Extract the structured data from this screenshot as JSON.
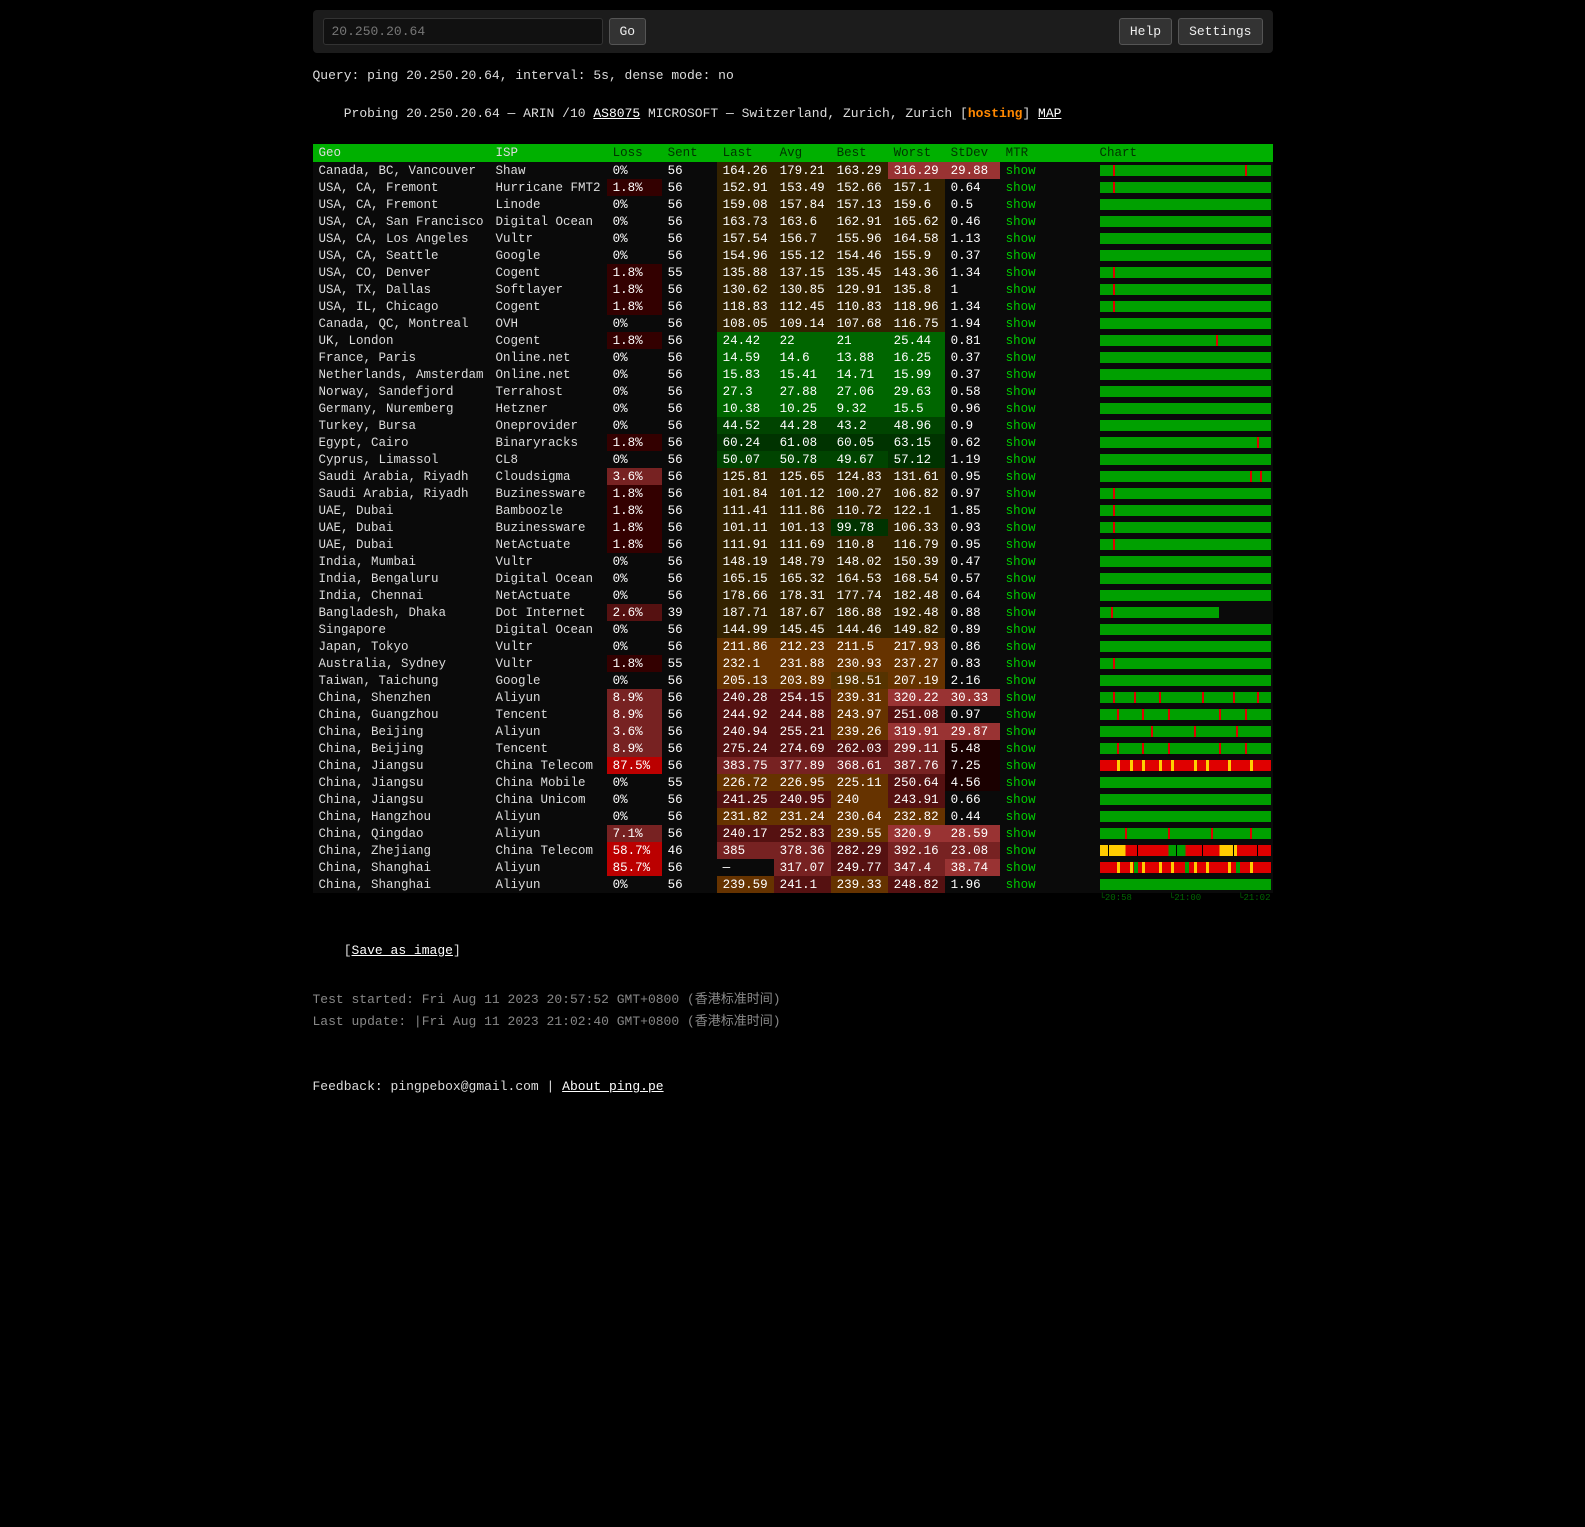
{
  "topbar": {
    "search_value": "20.250.20.64",
    "go_label": "Go",
    "help_label": "Help",
    "settings_label": "Settings"
  },
  "query_line": "Query: ping 20.250.20.64, interval: 5s, dense mode: no",
  "probe_line_pre": "Probing 20.250.20.64 — ARIN /10 ",
  "probe_asn": "AS8075",
  "probe_line_mid": " MICROSOFT — Switzerland, Zurich, Zurich [",
  "probe_hosting": "hosting",
  "probe_line_post": "] ",
  "probe_map": "MAP",
  "headers": {
    "geo": "Geo",
    "isp": "ISP",
    "loss": "Loss",
    "sent": "Sent",
    "last": "Last",
    "avg": "Avg",
    "best": "Best",
    "worst": "Worst",
    "stdev": "StDev",
    "mtr": "MTR",
    "chart": "Chart"
  },
  "mtr_show": "show",
  "rows": [
    {
      "geo": "Canada, BC, Vancouver",
      "isp": "Shaw",
      "loss": "0%",
      "sent": "56",
      "last": "164.26",
      "avg": "179.21",
      "best": "163.29",
      "worst": "316.29",
      "stdev": "29.88",
      "loss_bg": "",
      "last_bg": "bg-y1",
      "avg_bg": "bg-y1",
      "best_bg": "bg-y1",
      "worst_bg": "bg-r3",
      "stdev_bg": "bg-r3",
      "chart": "green_marks"
    },
    {
      "geo": "USA, CA, Fremont",
      "isp": "Hurricane FMT2",
      "loss": "1.8%",
      "sent": "56",
      "last": "152.91",
      "avg": "153.49",
      "best": "152.66",
      "worst": "157.1",
      "stdev": "0.64",
      "loss_bg": "bg-r5",
      "last_bg": "bg-y1",
      "avg_bg": "bg-y1",
      "best_bg": "bg-y1",
      "worst_bg": "bg-y1",
      "stdev_bg": "",
      "chart": "green_1mark"
    },
    {
      "geo": "USA, CA, Fremont",
      "isp": "Linode",
      "loss": "0%",
      "sent": "56",
      "last": "159.08",
      "avg": "157.84",
      "best": "157.13",
      "worst": "159.6",
      "stdev": "0.5",
      "loss_bg": "",
      "last_bg": "bg-y1",
      "avg_bg": "bg-y1",
      "best_bg": "bg-y1",
      "worst_bg": "bg-y1",
      "stdev_bg": "",
      "chart": "green"
    },
    {
      "geo": "USA, CA, San Francisco",
      "isp": "Digital Ocean",
      "loss": "0%",
      "sent": "56",
      "last": "163.73",
      "avg": "163.6",
      "best": "162.91",
      "worst": "165.62",
      "stdev": "0.46",
      "loss_bg": "",
      "last_bg": "bg-y1",
      "avg_bg": "bg-y1",
      "best_bg": "bg-y1",
      "worst_bg": "bg-y1",
      "stdev_bg": "",
      "chart": "green"
    },
    {
      "geo": "USA, CA, Los Angeles",
      "isp": "Vultr",
      "loss": "0%",
      "sent": "56",
      "last": "157.54",
      "avg": "156.7",
      "best": "155.96",
      "worst": "164.58",
      "stdev": "1.13",
      "loss_bg": "",
      "last_bg": "bg-y1",
      "avg_bg": "bg-y1",
      "best_bg": "bg-y1",
      "worst_bg": "bg-y1",
      "stdev_bg": "",
      "chart": "green"
    },
    {
      "geo": "USA, CA, Seattle",
      "isp": "Google",
      "loss": "0%",
      "sent": "56",
      "last": "154.96",
      "avg": "155.12",
      "best": "154.46",
      "worst": "155.9",
      "stdev": "0.37",
      "loss_bg": "",
      "last_bg": "bg-y1",
      "avg_bg": "bg-y1",
      "best_bg": "bg-y1",
      "worst_bg": "bg-y1",
      "stdev_bg": "",
      "chart": "green"
    },
    {
      "geo": "USA, CO, Denver",
      "isp": "Cogent",
      "loss": "1.8%",
      "sent": "55",
      "last": "135.88",
      "avg": "137.15",
      "best": "135.45",
      "worst": "143.36",
      "stdev": "1.34",
      "loss_bg": "bg-r5",
      "last_bg": "bg-y1",
      "avg_bg": "bg-y1",
      "best_bg": "bg-y1",
      "worst_bg": "bg-y1",
      "stdev_bg": "",
      "chart": "green_1mark"
    },
    {
      "geo": "USA, TX, Dallas",
      "isp": "Softlayer",
      "loss": "1.8%",
      "sent": "56",
      "last": "130.62",
      "avg": "130.85",
      "best": "129.91",
      "worst": "135.8",
      "stdev": "1",
      "loss_bg": "bg-r5",
      "last_bg": "bg-y1",
      "avg_bg": "bg-y1",
      "best_bg": "bg-y1",
      "worst_bg": "bg-y1",
      "stdev_bg": "",
      "chart": "green_1mark"
    },
    {
      "geo": "USA, IL, Chicago",
      "isp": "Cogent",
      "loss": "1.8%",
      "sent": "56",
      "last": "118.83",
      "avg": "112.45",
      "best": "110.83",
      "worst": "118.96",
      "stdev": "1.34",
      "loss_bg": "bg-r5",
      "last_bg": "bg-y1",
      "avg_bg": "bg-y1",
      "best_bg": "bg-y1",
      "worst_bg": "bg-y1",
      "stdev_bg": "",
      "chart": "green_1mark"
    },
    {
      "geo": "Canada, QC, Montreal",
      "isp": "OVH",
      "loss": "0%",
      "sent": "56",
      "last": "108.05",
      "avg": "109.14",
      "best": "107.68",
      "worst": "116.75",
      "stdev": "1.94",
      "loss_bg": "",
      "last_bg": "bg-y1",
      "avg_bg": "bg-y1",
      "best_bg": "bg-y1",
      "worst_bg": "bg-y1",
      "stdev_bg": "",
      "chart": "green"
    },
    {
      "geo": "UK, London",
      "isp": "Cogent",
      "loss": "1.8%",
      "sent": "56",
      "last": "24.42",
      "avg": "22",
      "best": "21",
      "worst": "25.44",
      "stdev": "0.81",
      "loss_bg": "bg-r5",
      "last_bg": "bg-g3",
      "avg_bg": "bg-g3",
      "best_bg": "bg-g3",
      "worst_bg": "bg-g3",
      "stdev_bg": "",
      "chart": "green_1mark_mid"
    },
    {
      "geo": "France, Paris",
      "isp": "Online.net",
      "loss": "0%",
      "sent": "56",
      "last": "14.59",
      "avg": "14.6",
      "best": "13.88",
      "worst": "16.25",
      "stdev": "0.37",
      "loss_bg": "",
      "last_bg": "bg-g3",
      "avg_bg": "bg-g3",
      "best_bg": "bg-g3",
      "worst_bg": "bg-g3",
      "stdev_bg": "",
      "chart": "green"
    },
    {
      "geo": "Netherlands, Amsterdam",
      "isp": "Online.net",
      "loss": "0%",
      "sent": "56",
      "last": "15.83",
      "avg": "15.41",
      "best": "14.71",
      "worst": "15.99",
      "stdev": "0.37",
      "loss_bg": "",
      "last_bg": "bg-g3",
      "avg_bg": "bg-g3",
      "best_bg": "bg-g3",
      "worst_bg": "bg-g3",
      "stdev_bg": "",
      "chart": "green"
    },
    {
      "geo": "Norway, Sandefjord",
      "isp": "Terrahost",
      "loss": "0%",
      "sent": "56",
      "last": "27.3",
      "avg": "27.88",
      "best": "27.06",
      "worst": "29.63",
      "stdev": "0.58",
      "loss_bg": "",
      "last_bg": "bg-g3",
      "avg_bg": "bg-g3",
      "best_bg": "bg-g3",
      "worst_bg": "bg-g3",
      "stdev_bg": "",
      "chart": "green"
    },
    {
      "geo": "Germany, Nuremberg",
      "isp": "Hetzner",
      "loss": "0%",
      "sent": "56",
      "last": "10.38",
      "avg": "10.25",
      "best": "9.32",
      "worst": "15.5",
      "stdev": "0.96",
      "loss_bg": "",
      "last_bg": "bg-g3",
      "avg_bg": "bg-g3",
      "best_bg": "bg-g3",
      "worst_bg": "bg-g3",
      "stdev_bg": "",
      "chart": "green"
    },
    {
      "geo": "Turkey, Bursa",
      "isp": "Oneprovider",
      "loss": "0%",
      "sent": "56",
      "last": "44.52",
      "avg": "44.28",
      "best": "43.2",
      "worst": "48.96",
      "stdev": "0.9",
      "loss_bg": "",
      "last_bg": "bg-g2",
      "avg_bg": "bg-g2",
      "best_bg": "bg-g2",
      "worst_bg": "bg-g2",
      "stdev_bg": "",
      "chart": "green"
    },
    {
      "geo": "Egypt, Cairo",
      "isp": "Binaryracks",
      "loss": "1.8%",
      "sent": "56",
      "last": "60.24",
      "avg": "61.08",
      "best": "60.05",
      "worst": "63.15",
      "stdev": "0.62",
      "loss_bg": "bg-r5",
      "last_bg": "bg-g1",
      "avg_bg": "bg-g1",
      "best_bg": "bg-g1",
      "worst_bg": "bg-g1",
      "stdev_bg": "",
      "chart": "green_1mark_end"
    },
    {
      "geo": "Cyprus, Limassol",
      "isp": "CL8",
      "loss": "0%",
      "sent": "56",
      "last": "50.07",
      "avg": "50.78",
      "best": "49.67",
      "worst": "57.12",
      "stdev": "1.19",
      "loss_bg": "",
      "last_bg": "bg-g2",
      "avg_bg": "bg-g2",
      "best_bg": "bg-g2",
      "worst_bg": "bg-g1",
      "stdev_bg": "",
      "chart": "green"
    },
    {
      "geo": "Saudi Arabia, Riyadh",
      "isp": "Cloudsigma",
      "loss": "3.6%",
      "sent": "56",
      "last": "125.81",
      "avg": "125.65",
      "best": "124.83",
      "worst": "131.61",
      "stdev": "0.95",
      "loss_bg": "bg-r2",
      "last_bg": "bg-y1",
      "avg_bg": "bg-y1",
      "best_bg": "bg-y1",
      "worst_bg": "bg-y1",
      "stdev_bg": "",
      "chart": "green_2marks_end"
    },
    {
      "geo": "Saudi Arabia, Riyadh",
      "isp": "Buzinessware",
      "loss": "1.8%",
      "sent": "56",
      "last": "101.84",
      "avg": "101.12",
      "best": "100.27",
      "worst": "106.82",
      "stdev": "0.97",
      "loss_bg": "bg-r5",
      "last_bg": "bg-y1",
      "avg_bg": "bg-y1",
      "best_bg": "bg-y1",
      "worst_bg": "bg-y1",
      "stdev_bg": "",
      "chart": "green_1mark"
    },
    {
      "geo": "UAE, Dubai",
      "isp": "Bamboozle",
      "loss": "1.8%",
      "sent": "56",
      "last": "111.41",
      "avg": "111.86",
      "best": "110.72",
      "worst": "122.1",
      "stdev": "1.85",
      "loss_bg": "bg-r5",
      "last_bg": "bg-y1",
      "avg_bg": "bg-y1",
      "best_bg": "bg-y1",
      "worst_bg": "bg-y1",
      "stdev_bg": "",
      "chart": "green_1mark"
    },
    {
      "geo": "UAE, Dubai",
      "isp": "Buzinessware",
      "loss": "1.8%",
      "sent": "56",
      "last": "101.11",
      "avg": "101.13",
      "best": "99.78",
      "worst": "106.33",
      "stdev": "0.93",
      "loss_bg": "bg-r5",
      "last_bg": "bg-y1",
      "avg_bg": "bg-y1",
      "best_bg": "bg-g1",
      "worst_bg": "bg-y1",
      "stdev_bg": "",
      "chart": "green_1mark"
    },
    {
      "geo": "UAE, Dubai",
      "isp": "NetActuate",
      "loss": "1.8%",
      "sent": "56",
      "last": "111.91",
      "avg": "111.69",
      "best": "110.8",
      "worst": "116.79",
      "stdev": "0.95",
      "loss_bg": "bg-r5",
      "last_bg": "bg-y1",
      "avg_bg": "bg-y1",
      "best_bg": "bg-y1",
      "worst_bg": "bg-y1",
      "stdev_bg": "",
      "chart": "green_1mark"
    },
    {
      "geo": "India, Mumbai",
      "isp": "Vultr",
      "loss": "0%",
      "sent": "56",
      "last": "148.19",
      "avg": "148.79",
      "best": "148.02",
      "worst": "150.39",
      "stdev": "0.47",
      "loss_bg": "",
      "last_bg": "bg-y1",
      "avg_bg": "bg-y1",
      "best_bg": "bg-y1",
      "worst_bg": "bg-y1",
      "stdev_bg": "",
      "chart": "green"
    },
    {
      "geo": "India, Bengaluru",
      "isp": "Digital Ocean",
      "loss": "0%",
      "sent": "56",
      "last": "165.15",
      "avg": "165.32",
      "best": "164.53",
      "worst": "168.54",
      "stdev": "0.57",
      "loss_bg": "",
      "last_bg": "bg-y1",
      "avg_bg": "bg-y1",
      "best_bg": "bg-y1",
      "worst_bg": "bg-y1",
      "stdev_bg": "",
      "chart": "green"
    },
    {
      "geo": "India, Chennai",
      "isp": "NetActuate",
      "loss": "0%",
      "sent": "56",
      "last": "178.66",
      "avg": "178.31",
      "best": "177.74",
      "worst": "182.48",
      "stdev": "0.64",
      "loss_bg": "",
      "last_bg": "bg-y1",
      "avg_bg": "bg-y1",
      "best_bg": "bg-y1",
      "worst_bg": "bg-y1",
      "stdev_bg": "",
      "chart": "green"
    },
    {
      "geo": "Bangladesh, Dhaka",
      "isp": "Dot Internet",
      "loss": "2.6%",
      "sent": "39",
      "last": "187.71",
      "avg": "187.67",
      "best": "186.88",
      "worst": "192.48",
      "stdev": "0.88",
      "loss_bg": "bg-r1",
      "last_bg": "bg-y1",
      "avg_bg": "bg-y1",
      "best_bg": "bg-y1",
      "worst_bg": "bg-y1",
      "stdev_bg": "",
      "chart": "green_short"
    },
    {
      "geo": "Singapore",
      "isp": "Digital Ocean",
      "loss": "0%",
      "sent": "56",
      "last": "144.99",
      "avg": "145.45",
      "best": "144.46",
      "worst": "149.82",
      "stdev": "0.89",
      "loss_bg": "",
      "last_bg": "bg-y1",
      "avg_bg": "bg-y1",
      "best_bg": "bg-y1",
      "worst_bg": "bg-y1",
      "stdev_bg": "",
      "chart": "green"
    },
    {
      "geo": "Japan, Tokyo",
      "isp": "Vultr",
      "loss": "0%",
      "sent": "56",
      "last": "211.86",
      "avg": "212.23",
      "best": "211.5",
      "worst": "217.93",
      "stdev": "0.86",
      "loss_bg": "",
      "last_bg": "bg-o1",
      "avg_bg": "bg-o1",
      "best_bg": "bg-o1",
      "worst_bg": "bg-o1",
      "stdev_bg": "",
      "chart": "green"
    },
    {
      "geo": "Australia, Sydney",
      "isp": "Vultr",
      "loss": "1.8%",
      "sent": "55",
      "last": "232.1",
      "avg": "231.88",
      "best": "230.93",
      "worst": "237.27",
      "stdev": "0.83",
      "loss_bg": "bg-r5",
      "last_bg": "bg-o1",
      "avg_bg": "bg-o1",
      "best_bg": "bg-o1",
      "worst_bg": "bg-o1",
      "stdev_bg": "",
      "chart": "green_1mark"
    },
    {
      "geo": "Taiwan, Taichung",
      "isp": "Google",
      "loss": "0%",
      "sent": "56",
      "last": "205.13",
      "avg": "203.89",
      "best": "198.51",
      "worst": "207.19",
      "stdev": "2.16",
      "loss_bg": "",
      "last_bg": "bg-o1",
      "avg_bg": "bg-o1",
      "best_bg": "bg-y2",
      "worst_bg": "bg-o1",
      "stdev_bg": "",
      "chart": "green"
    },
    {
      "geo": "China, Shenzhen",
      "isp": "Aliyun",
      "loss": "8.9%",
      "sent": "56",
      "last": "240.28",
      "avg": "254.15",
      "best": "239.31",
      "worst": "320.22",
      "stdev": "30.33",
      "loss_bg": "bg-r2",
      "last_bg": "bg-r1",
      "avg_bg": "bg-r1",
      "best_bg": "bg-o1",
      "worst_bg": "bg-r3",
      "stdev_bg": "bg-r3",
      "chart": "mixed_5marks"
    },
    {
      "geo": "China, Guangzhou",
      "isp": "Tencent",
      "loss": "8.9%",
      "sent": "56",
      "last": "244.92",
      "avg": "244.88",
      "best": "243.97",
      "worst": "251.08",
      "stdev": "0.97",
      "loss_bg": "bg-r2",
      "last_bg": "bg-r1",
      "avg_bg": "bg-r1",
      "best_bg": "bg-o1",
      "worst_bg": "bg-r1",
      "stdev_bg": "",
      "chart": "green_5marks"
    },
    {
      "geo": "China, Beijing",
      "isp": "Aliyun",
      "loss": "3.6%",
      "sent": "56",
      "last": "240.94",
      "avg": "255.21",
      "best": "239.26",
      "worst": "319.91",
      "stdev": "29.87",
      "loss_bg": "bg-r2",
      "last_bg": "bg-r1",
      "avg_bg": "bg-r1",
      "best_bg": "bg-o1",
      "worst_bg": "bg-r3",
      "stdev_bg": "bg-r3",
      "chart": "mixed_3marks"
    },
    {
      "geo": "China, Beijing",
      "isp": "Tencent",
      "loss": "8.9%",
      "sent": "56",
      "last": "275.24",
      "avg": "274.69",
      "best": "262.03",
      "worst": "299.11",
      "stdev": "5.48",
      "loss_bg": "bg-r2",
      "last_bg": "bg-r1",
      "avg_bg": "bg-r1",
      "best_bg": "bg-r1",
      "worst_bg": "bg-r2",
      "stdev_bg": "bg-dark",
      "chart": "green_5marks"
    },
    {
      "geo": "China, Jiangsu",
      "isp": "China Telecom",
      "loss": "87.5%",
      "sent": "56",
      "last": "383.75",
      "avg": "377.89",
      "best": "368.61",
      "worst": "387.76",
      "stdev": "7.25",
      "loss_bg": "bg-r4",
      "last_bg": "bg-r2",
      "avg_bg": "bg-r2",
      "best_bg": "bg-r2",
      "worst_bg": "bg-r2",
      "stdev_bg": "bg-dark",
      "chart": "red_full"
    },
    {
      "geo": "China, Jiangsu",
      "isp": "China Mobile",
      "loss": "0%",
      "sent": "55",
      "last": "226.72",
      "avg": "226.95",
      "best": "225.11",
      "worst": "250.64",
      "stdev": "4.56",
      "loss_bg": "",
      "last_bg": "bg-o1",
      "avg_bg": "bg-o1",
      "best_bg": "bg-o1",
      "worst_bg": "bg-r1",
      "stdev_bg": "bg-dark",
      "chart": "green"
    },
    {
      "geo": "China, Jiangsu",
      "isp": "China Unicom",
      "loss": "0%",
      "sent": "56",
      "last": "241.25",
      "avg": "240.95",
      "best": "240",
      "worst": "243.91",
      "stdev": "0.66",
      "loss_bg": "",
      "last_bg": "bg-r1",
      "avg_bg": "bg-r1",
      "best_bg": "bg-o1",
      "worst_bg": "bg-r1",
      "stdev_bg": "",
      "chart": "green"
    },
    {
      "geo": "China, Hangzhou",
      "isp": "Aliyun",
      "loss": "0%",
      "sent": "56",
      "last": "231.82",
      "avg": "231.24",
      "best": "230.64",
      "worst": "232.82",
      "stdev": "0.44",
      "loss_bg": "",
      "last_bg": "bg-o1",
      "avg_bg": "bg-o1",
      "best_bg": "bg-o1",
      "worst_bg": "bg-o1",
      "stdev_bg": "",
      "chart": "green"
    },
    {
      "geo": "China, Qingdao",
      "isp": "Aliyun",
      "loss": "7.1%",
      "sent": "56",
      "last": "240.17",
      "avg": "252.83",
      "best": "239.55",
      "worst": "320.9",
      "stdev": "28.59",
      "loss_bg": "bg-r2",
      "last_bg": "bg-r1",
      "avg_bg": "bg-r1",
      "best_bg": "bg-o1",
      "worst_bg": "bg-r3",
      "stdev_bg": "bg-r3",
      "chart": "mixed_4marks"
    },
    {
      "geo": "China, Zhejiang",
      "isp": "China Telecom",
      "loss": "58.7%",
      "sent": "46",
      "last": "385",
      "avg": "378.36",
      "best": "282.29",
      "worst": "392.16",
      "stdev": "23.08",
      "loss_bg": "bg-r4",
      "last_bg": "bg-r2",
      "avg_bg": "bg-r2",
      "best_bg": "bg-r1",
      "worst_bg": "bg-r2",
      "stdev_bg": "bg-r2",
      "chart": "red_yellow"
    },
    {
      "geo": "China, Shanghai",
      "isp": "Aliyun",
      "loss": "85.7%",
      "sent": "56",
      "last": "—",
      "avg": "317.07",
      "best": "249.77",
      "worst": "347.4",
      "stdev": "38.74",
      "loss_bg": "bg-r4",
      "last_bg": "",
      "avg_bg": "bg-r2",
      "best_bg": "bg-r1",
      "worst_bg": "bg-r2",
      "stdev_bg": "bg-r3",
      "chart": "red_full2"
    },
    {
      "geo": "China, Shanghai",
      "isp": "Aliyun",
      "loss": "0%",
      "sent": "56",
      "last": "239.59",
      "avg": "241.1",
      "best": "239.33",
      "worst": "248.82",
      "stdev": "1.96",
      "loss_bg": "",
      "last_bg": "bg-o1",
      "avg_bg": "bg-r1",
      "best_bg": "bg-o1",
      "worst_bg": "bg-r1",
      "stdev_bg": "",
      "chart": "green"
    }
  ],
  "time_labels": {
    "t1": "20:58",
    "t2": "21:00",
    "t3": "21:02"
  },
  "save_label": "Save as image",
  "test_started": "Test started: Fri Aug 11 2023 20:57:52 GMT+0800 (香港标准时间)",
  "last_update": "Last update: |Fri Aug 11 2023 21:02:40 GMT+0800 (香港标准时间)",
  "footer_feedback": "Feedback: pingpebox@gmail.com | ",
  "footer_about": "About ping.pe"
}
